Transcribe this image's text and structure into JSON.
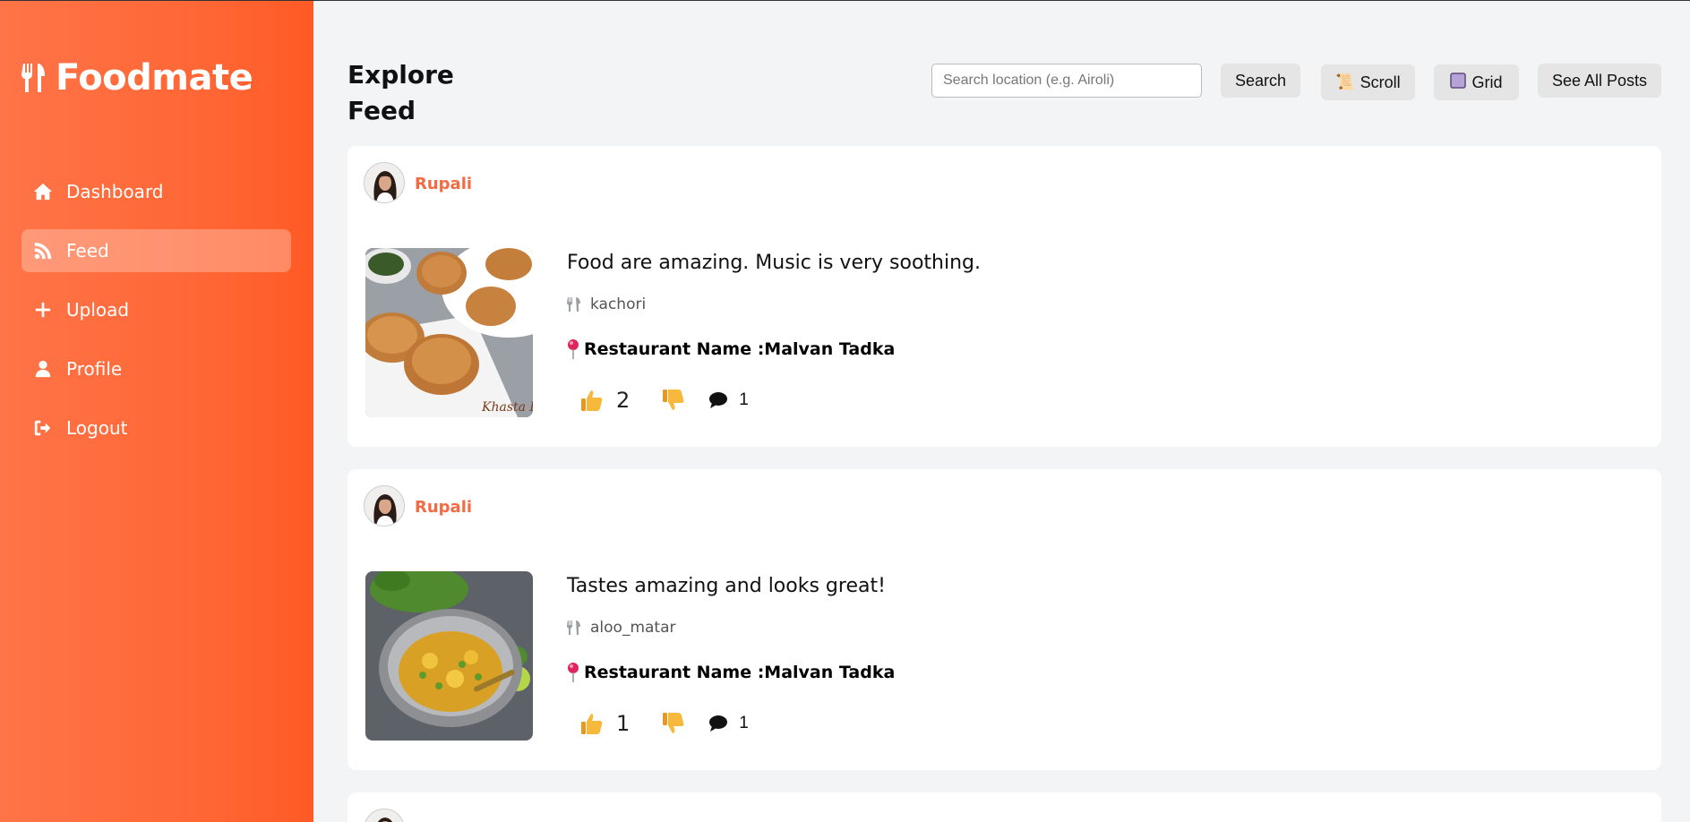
{
  "app": {
    "brand": "Foodmate",
    "brand_icon": "utensils-icon",
    "accent": "#ff6533"
  },
  "sidebar": {
    "items": [
      {
        "label": "Dashboard",
        "icon": "home-icon",
        "active": false
      },
      {
        "label": "Feed",
        "icon": "rss-icon",
        "active": true
      },
      {
        "label": "Upload",
        "icon": "plus-icon",
        "active": false
      },
      {
        "label": "Profile",
        "icon": "user-icon",
        "active": false
      },
      {
        "label": "Logout",
        "icon": "logout-icon",
        "active": false
      }
    ]
  },
  "header": {
    "title": "Explore Feed",
    "search_placeholder": "Search location (e.g. Airoli)",
    "search_value": "",
    "search_button": "Search",
    "scroll_button": "Scroll",
    "scroll_icon": "scroll-icon",
    "grid_button": "Grid",
    "grid_icon": "grid-icon",
    "see_all_button": "See All Posts"
  },
  "posts": [
    {
      "username": "Rupali",
      "caption": "Food are amazing. Music is very soothing.",
      "dish": "kachori",
      "restaurant_label": "Restaurant Name : ",
      "restaurant_name": "Malvan Tadka",
      "likes": "2",
      "comments": "1",
      "image": "kachori-photo"
    },
    {
      "username": "Rupali",
      "caption": "Tastes amazing and looks great!",
      "dish": "aloo_matar",
      "restaurant_label": "Restaurant Name : ",
      "restaurant_name": "Malvan Tadka",
      "likes": "1",
      "comments": "1",
      "image": "aloo-matar-photo"
    }
  ]
}
